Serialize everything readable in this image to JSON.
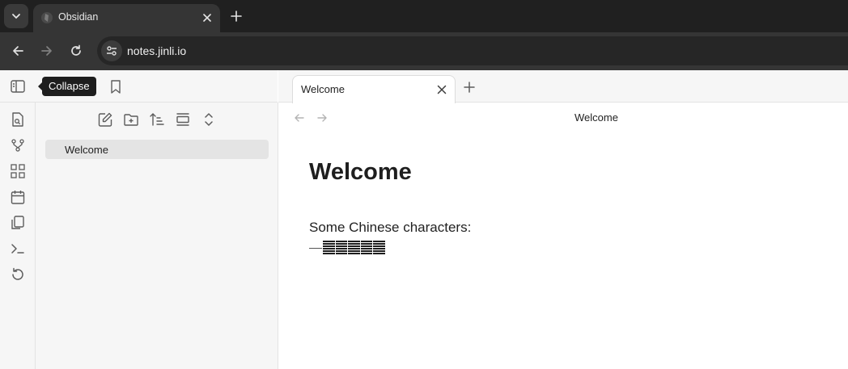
{
  "browser": {
    "tab_title": "Obsidian",
    "url": "notes.jinli.io"
  },
  "obsidian": {
    "tooltip": "Collapse",
    "files": [
      {
        "label": "Welcome"
      }
    ],
    "open_tab": "Welcome",
    "view_title": "Welcome",
    "note": {
      "heading": "Welcome",
      "paragraph": "Some Chinese characters:",
      "chinese_line": "一二三四五"
    }
  },
  "colors": {
    "chrome_dark": "#202020",
    "chrome_toolbar": "#353535",
    "sidebar_bg": "#f6f6f6",
    "active_file_bg": "#e4e4e4",
    "tooltip_bg": "#1e1e1e"
  }
}
